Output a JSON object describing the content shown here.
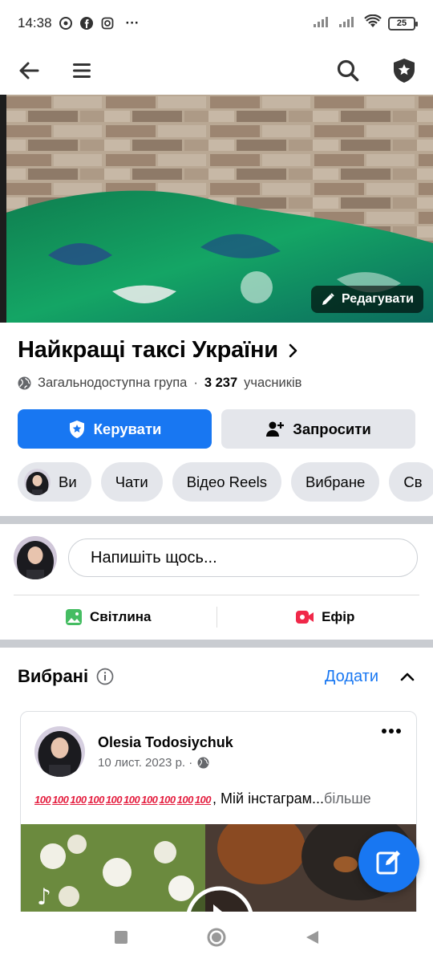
{
  "status_bar": {
    "time": "14:38",
    "overflow": "···",
    "battery": "25",
    "icons": [
      "chrome-icon",
      "facebook-icon",
      "instagram-icon",
      "signal-icon",
      "wifi-icon"
    ]
  },
  "nav": {
    "icons": [
      "back-arrow-icon",
      "menu-icon",
      "search-icon",
      "admin-shield-icon"
    ]
  },
  "cover": {
    "edit_label": "Редагувати"
  },
  "group": {
    "name": "Найкращі таксі України",
    "privacy": "Загальнодоступна група",
    "separator": "·",
    "member_count": "3 237",
    "members_label": "учасників"
  },
  "actions": {
    "manage_label": "Керувати",
    "invite_label": "Запросити"
  },
  "chips": [
    "Ви",
    "Чати",
    "Відео Reels",
    "Вибране",
    "Св"
  ],
  "composer": {
    "placeholder": "Напишіть щось...",
    "photo_label": "Світлина",
    "live_label": "Ефір"
  },
  "featured": {
    "title": "Вибрані",
    "add_label": "Додати"
  },
  "post": {
    "author": "Olesia Todosiychuk",
    "date": "10 лист. 2023 р. ·",
    "emoji_count": 10,
    "emoji_text": "100",
    "text": ", Мій інстаграм...",
    "more_label": "більше"
  },
  "colors": {
    "brand_blue": "#1877f2",
    "chip_bg": "#e4e6eb",
    "divider": "#c9ccd1",
    "live_red": "#f02849",
    "photo_green": "#45bd62"
  }
}
